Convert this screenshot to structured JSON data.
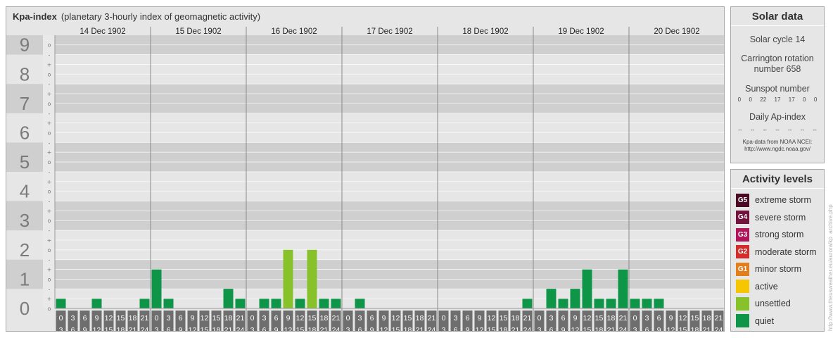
{
  "title": {
    "main": "Kpa-index",
    "subtitle": "(planetary 3-hourly index of geomagnetic activity)"
  },
  "chart_data": {
    "type": "bar",
    "y_ticks": [
      "0",
      "1",
      "2",
      "3",
      "4",
      "5",
      "6",
      "7",
      "8",
      "9"
    ],
    "minor_ticks": [
      "o",
      "+",
      "-",
      "o",
      "+",
      "-",
      "o",
      "+",
      "-",
      "o",
      "+",
      "-",
      "o",
      "+",
      "-",
      "o",
      "+",
      "-",
      "o",
      "+",
      "-",
      "o",
      "+",
      "-",
      "o",
      "+",
      "-",
      "o"
    ],
    "ylim": [
      0,
      9.33
    ],
    "days": [
      "14 Dec 1902",
      "15 Dec 1902",
      "16 Dec 1902",
      "17 Dec 1902",
      "18 Dec 1902",
      "19 Dec 1902",
      "20 Dec 1902"
    ],
    "hour_start": [
      "0",
      "3",
      "6",
      "9",
      "12",
      "15",
      "18",
      "21"
    ],
    "hour_end": [
      "3",
      "6",
      "9",
      "12",
      "15",
      "18",
      "21",
      "24"
    ],
    "values": [
      0.33,
      0,
      0,
      0.33,
      0,
      0,
      0,
      0.33,
      1.33,
      0.33,
      0,
      0,
      0,
      0,
      0.67,
      0.33,
      0,
      0.33,
      0.33,
      2.0,
      0.33,
      2.0,
      0.33,
      0.33,
      0,
      0.33,
      0,
      0,
      0,
      0,
      0,
      0,
      0,
      0,
      0,
      0,
      0,
      0,
      0,
      0.33,
      0,
      0.67,
      0.33,
      0.67,
      1.33,
      0.33,
      0.33,
      1.33,
      0.33,
      0.33,
      0.33,
      0,
      0,
      0,
      0,
      0
    ],
    "colors": {
      "quiet": "#0f9548",
      "unsettled": "#88c22a",
      "active": "#f6c602",
      "minor_storm": "#e37e1d",
      "moderate_storm": "#d62b2b",
      "strong_storm": "#b2145a",
      "severe_storm": "#73123c",
      "extreme_storm": "#4b0a24"
    }
  },
  "solar": {
    "heading": "Solar data",
    "cycle": "Solar cycle 14",
    "rotation_line1": "Carrington rotation",
    "rotation_line2": "number 658",
    "sunspot_label": "Sunspot number",
    "sunspots": [
      "0",
      "0",
      "22",
      "17",
      "17",
      "0",
      "0"
    ],
    "ap_label": "Daily Ap-index",
    "ap": [
      "--",
      "--",
      "--",
      "--",
      "--",
      "--",
      "--"
    ],
    "source_line1": "Kpa-data from NOAA NCEI:",
    "source_line2": "http://www.ngdc.noaa.gov/"
  },
  "activity": {
    "heading": "Activity levels",
    "levels": [
      {
        "badge": "G5",
        "label": "extreme storm",
        "color": "#4b0a24"
      },
      {
        "badge": "G4",
        "label": "severe storm",
        "color": "#73123c"
      },
      {
        "badge": "G3",
        "label": "strong storm",
        "color": "#b2145a"
      },
      {
        "badge": "G2",
        "label": "moderate storm",
        "color": "#d62b2b"
      },
      {
        "badge": "G1",
        "label": "minor storm",
        "color": "#e37e1d"
      },
      {
        "badge": "",
        "label": "active",
        "color": "#f6c602"
      },
      {
        "badge": "",
        "label": "unsettled",
        "color": "#88c22a"
      },
      {
        "badge": "",
        "label": "quiet",
        "color": "#0f9548"
      }
    ]
  },
  "credit": "http://www.theusweather.eu/aurora/kp_archive.php"
}
